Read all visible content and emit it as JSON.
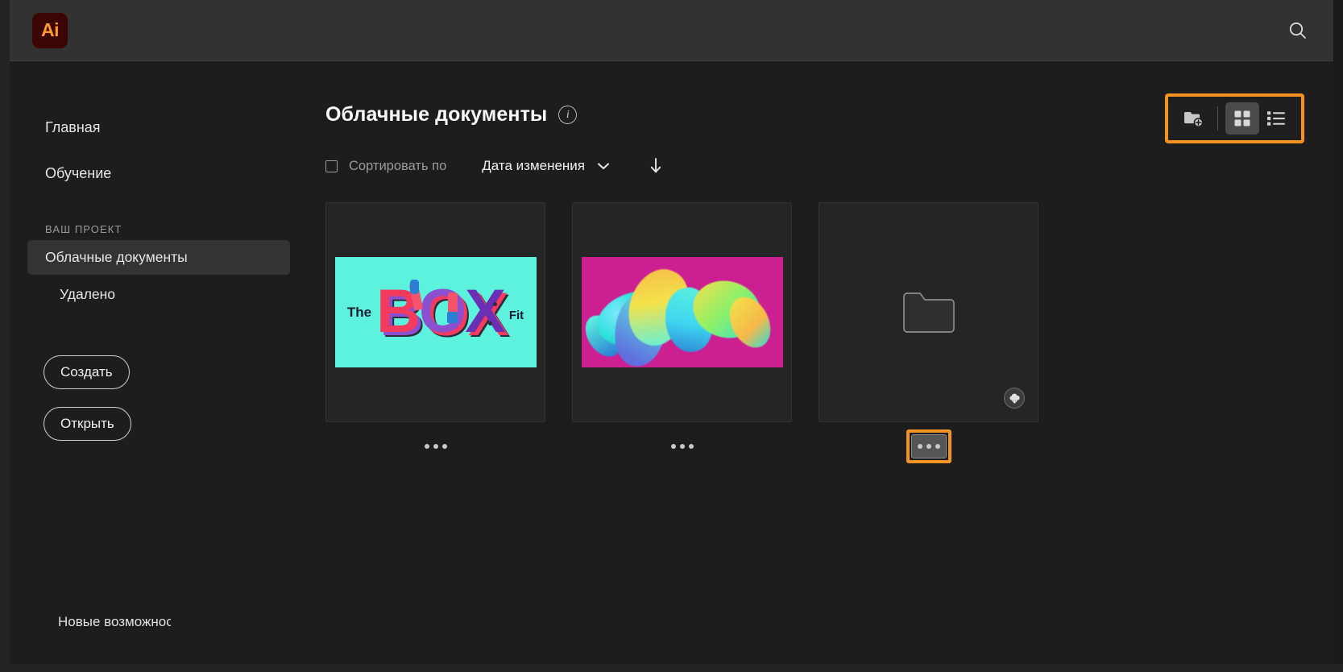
{
  "app": {
    "logo_text": "Ai",
    "logo_name": "adobe-illustrator-logo",
    "brand_color": "#ff9a2e",
    "accent_highlight_color": "#f59322"
  },
  "topbar": {
    "search_icon": "search-icon"
  },
  "sidebar": {
    "top_items": [
      {
        "label": "Главная",
        "name": "sidebar-item-home"
      },
      {
        "label": "Обучение",
        "name": "sidebar-item-learn"
      }
    ],
    "section_label": "ВАШ ПРОЕКТ",
    "project_items": [
      {
        "label": "Облачные документы",
        "name": "sidebar-item-cloud-documents",
        "active": true
      },
      {
        "label": "Удалено",
        "name": "sidebar-item-deleted",
        "active": false
      }
    ],
    "buttons": [
      {
        "label": "Создать",
        "name": "create-button"
      },
      {
        "label": "Открыть",
        "name": "open-button"
      }
    ],
    "whats_new": "Новые возможност"
  },
  "main": {
    "title": "Облачные документы",
    "info_icon": "info-icon",
    "sort": {
      "select_all_checked": false,
      "label": "Сортировать по",
      "value": "Дата изменения",
      "chevron_icon": "chevron-down-icon",
      "direction_icon": "arrow-down-icon",
      "direction": "descending"
    },
    "view_toolbar": {
      "highlighted": true,
      "buttons": [
        {
          "name": "new-folder-button",
          "icon": "new-folder-icon",
          "selected": false
        },
        {
          "name": "grid-view-button",
          "icon": "grid-view-icon",
          "selected": true
        },
        {
          "name": "list-view-button",
          "icon": "list-view-icon",
          "selected": false
        }
      ]
    },
    "documents": [
      {
        "name": "document-card-the-box-fit",
        "kind": "artwork",
        "thumb": "the-box-fit-artwork",
        "thumb_bg": "#5cf2de",
        "text_the": "The",
        "text_box": "BOX",
        "text_fit": "Fit",
        "overflow": {
          "name": "document-overflow-button",
          "icon": "more-options-icon",
          "focused": false,
          "highlighted": false
        }
      },
      {
        "name": "document-card-lettering",
        "kind": "artwork",
        "thumb": "gradient-lettering-artwork",
        "thumb_bg": "#cc1f92",
        "overflow": {
          "name": "document-overflow-button",
          "icon": "more-options-icon",
          "focused": false,
          "highlighted": false
        }
      },
      {
        "name": "document-card-folder",
        "kind": "folder",
        "thumb": "folder-icon",
        "badge_icon": "cloud-download-icon",
        "overflow": {
          "name": "document-overflow-button",
          "icon": "more-options-icon",
          "focused": true,
          "highlighted": true
        }
      }
    ]
  }
}
